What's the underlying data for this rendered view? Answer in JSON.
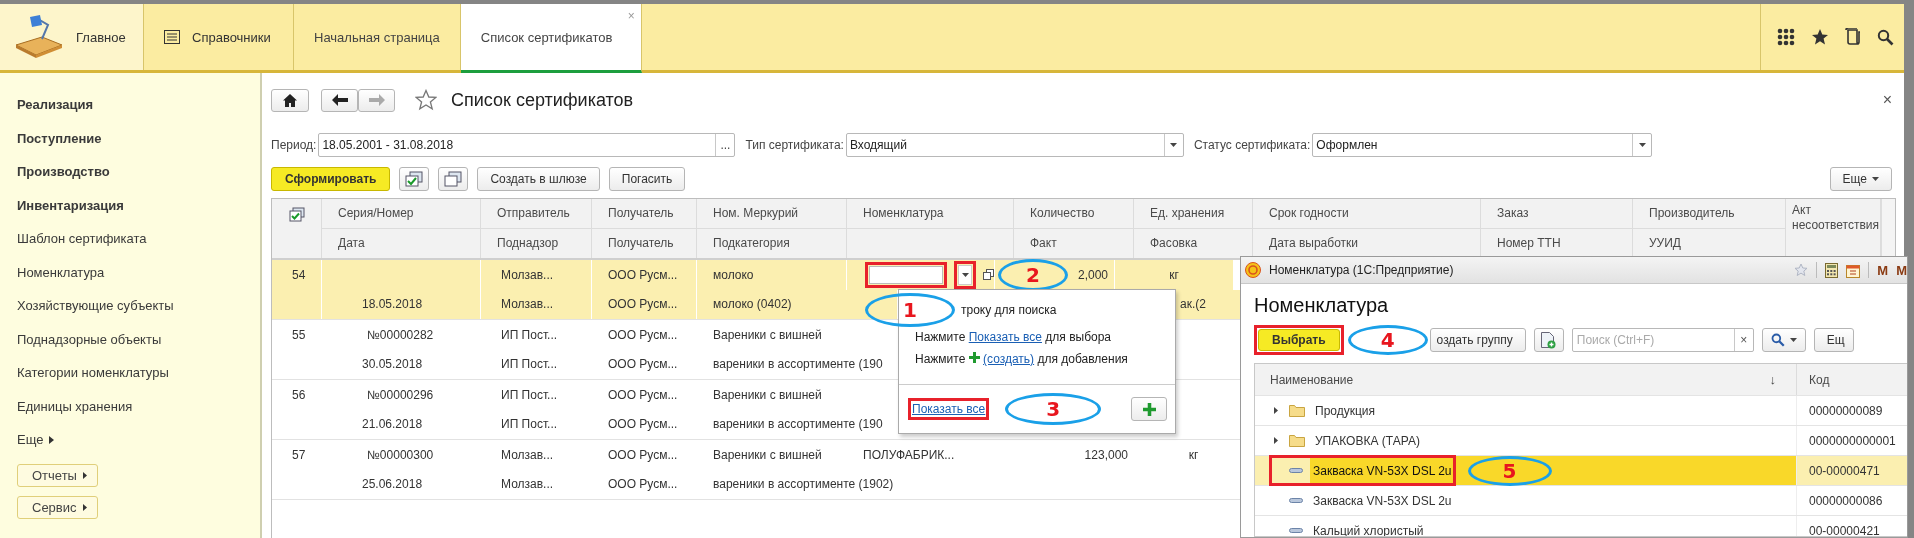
{
  "topbar": {
    "sections": [
      {
        "kind": "home",
        "label": "Главное"
      },
      {
        "kind": "menu",
        "label": "Справочники"
      }
    ],
    "tabs": [
      {
        "label": "Начальная страница",
        "selected": false
      },
      {
        "label": "Список сертификатов",
        "selected": true,
        "close": "×"
      }
    ]
  },
  "sidebar": {
    "items": [
      {
        "label": "Реализация",
        "bold": true
      },
      {
        "label": "Поступление",
        "bold": true
      },
      {
        "label": "Производство",
        "bold": true
      },
      {
        "label": "Инвентаризация",
        "bold": true
      },
      {
        "label": "Шаблон сертификата",
        "bold": false
      },
      {
        "label": "Номенклатура",
        "bold": false
      },
      {
        "label": "Хозяйствующие субъекты",
        "bold": false
      },
      {
        "label": "Поднадзорные объекты",
        "bold": false
      },
      {
        "label": "Категории номенклатуры",
        "bold": false
      },
      {
        "label": "Единицы хранения",
        "bold": false
      }
    ],
    "more": "Еще",
    "buttons": [
      "Отчеты",
      "Сервис"
    ]
  },
  "page": {
    "title": "Список сертификатов",
    "close": "×"
  },
  "filters": [
    {
      "kind": "choice",
      "label": "Период:",
      "value": "18.05.2001 - 31.08.2018",
      "button": "..."
    },
    {
      "kind": "dropdown",
      "label": "Тип сертификата:",
      "value": "Входящий"
    },
    {
      "kind": "dropdown",
      "label": "Статус сертификата:",
      "value": "Оформлен"
    }
  ],
  "toolbar": {
    "buttons": [
      {
        "kind": "primary",
        "label": "Сформировать"
      },
      {
        "kind": "icon"
      },
      {
        "kind": "icon"
      },
      {
        "kind": "text",
        "label": "Создать в шлюзе"
      },
      {
        "kind": "text",
        "label": "Погасить"
      }
    ],
    "more": "Еще"
  },
  "table": {
    "columns": [
      {
        "top": "Серия/Номер",
        "bottom": "Дата"
      },
      {
        "top": "Отправитель",
        "bottom": "Поднадзор"
      },
      {
        "top": "Получатель",
        "bottom": "Получатель"
      },
      {
        "top": "Ном. Меркурий",
        "bottom": "Подкатегория"
      },
      {
        "top": "Номенклатура"
      },
      {
        "top": "Количество",
        "bottom": "Факт"
      },
      {
        "top": "Ед. хранения",
        "bottom": "Фасовка"
      },
      {
        "top": "Срок годности",
        "bottom": "Дата выработки"
      },
      {
        "top": "Заказ",
        "bottom": "Номер ТТН"
      },
      {
        "top": "Производитель",
        "bottom": "УУИД"
      },
      {
        "top": "Акт несоответствия",
        "span": true
      }
    ],
    "rows": [
      {
        "number": "54",
        "selected": true,
        "editor": {
          "framed": true,
          "button_framed": true
        },
        "line1": {
          "sender": "Молзав...",
          "receiver": "ООО Русм...",
          "mercury": "молоко",
          "quantity": "2,000",
          "unit": "кг"
        },
        "line2": {
          "series": "18.05.2018",
          "sender": "Молзав...",
          "receiver": "ООО Русм...",
          "mercury": "молоко (0402)",
          "unit": "ак.(2"
        }
      },
      {
        "number": "55",
        "selected": false,
        "line1": {
          "series": "№00000282",
          "sender": "ИП Пост...",
          "receiver": "ООО Русм...",
          "mercury": "Вареники с вишней"
        },
        "line2": {
          "series": "30.05.2018",
          "sender": "ИП Пост...",
          "receiver": "ООО Русм...",
          "mercury": "вареники в ассортименте (190"
        }
      },
      {
        "number": "56",
        "selected": false,
        "line1": {
          "series": "№00000296",
          "sender": "ИП Пост...",
          "receiver": "ООО Русм...",
          "mercury": "Вареники с вишней"
        },
        "line2": {
          "series": "21.06.2018",
          "sender": "ИП Пост...",
          "receiver": "ООО Русм...",
          "mercury": "вареники в ассортименте (190"
        }
      },
      {
        "number": "57",
        "selected": false,
        "line1": {
          "series": "№00000300",
          "sender": "Молзав...",
          "receiver": "ООО Русм...",
          "mercury": "Вареники с вишней",
          "nomenclature": "ПОЛУФАБРИК...",
          "quantity": "123,000",
          "unit": "кг"
        },
        "line2": {
          "series": "25.06.2018",
          "sender": "Молзав...",
          "receiver": "ООО Русм...",
          "mercury": "вареники в ассортименте (1902)"
        }
      }
    ]
  },
  "popup": {
    "lines": [
      {
        "kind": "text",
        "text": "троку для поиска"
      },
      {
        "kind": "link",
        "before": "Нажмите",
        "link": "Показать все",
        "after": "для выбора"
      },
      {
        "kind": "create",
        "before": "Нажмите",
        "link": "(создать)",
        "after": "для добавления"
      }
    ],
    "footer_link": {
      "text": "Показать все",
      "framed": true
    }
  },
  "callouts": [
    "1",
    "2",
    "3",
    "4",
    "5"
  ],
  "window": {
    "title": "Номенклатура (1С:Предприятие)",
    "title_buttons": [
      "M",
      "M"
    ],
    "heading": "Номенклатура",
    "toolbar": {
      "select": {
        "label": "Выбрать",
        "framed": true
      },
      "create_group": "оздать группу",
      "search_placeholder": "Поиск (Ctrl+F)",
      "clear": "×",
      "more": "Ещ"
    },
    "columns": {
      "name": "Наименование",
      "sort": "↓",
      "code": "Код"
    },
    "rows": [
      {
        "kind": "folder",
        "name": "Продукция",
        "code": "00000000089",
        "selected": false,
        "framed": false
      },
      {
        "kind": "folder",
        "name": "УПАКОВКА (ТАРА)",
        "code": "0000000000001",
        "selected": false,
        "framed": false
      },
      {
        "kind": "item",
        "name": "Закваска VN-53X DSL 2u",
        "code": "00-00000471",
        "selected": true,
        "framed": true
      },
      {
        "kind": "item",
        "name": "Закваска VN-53X DSL 2u",
        "code": "00000000086",
        "selected": false,
        "framed": false
      },
      {
        "kind": "item",
        "name": "Кальций хлористый",
        "code": "00-00000421",
        "selected": false,
        "framed": false
      }
    ]
  }
}
